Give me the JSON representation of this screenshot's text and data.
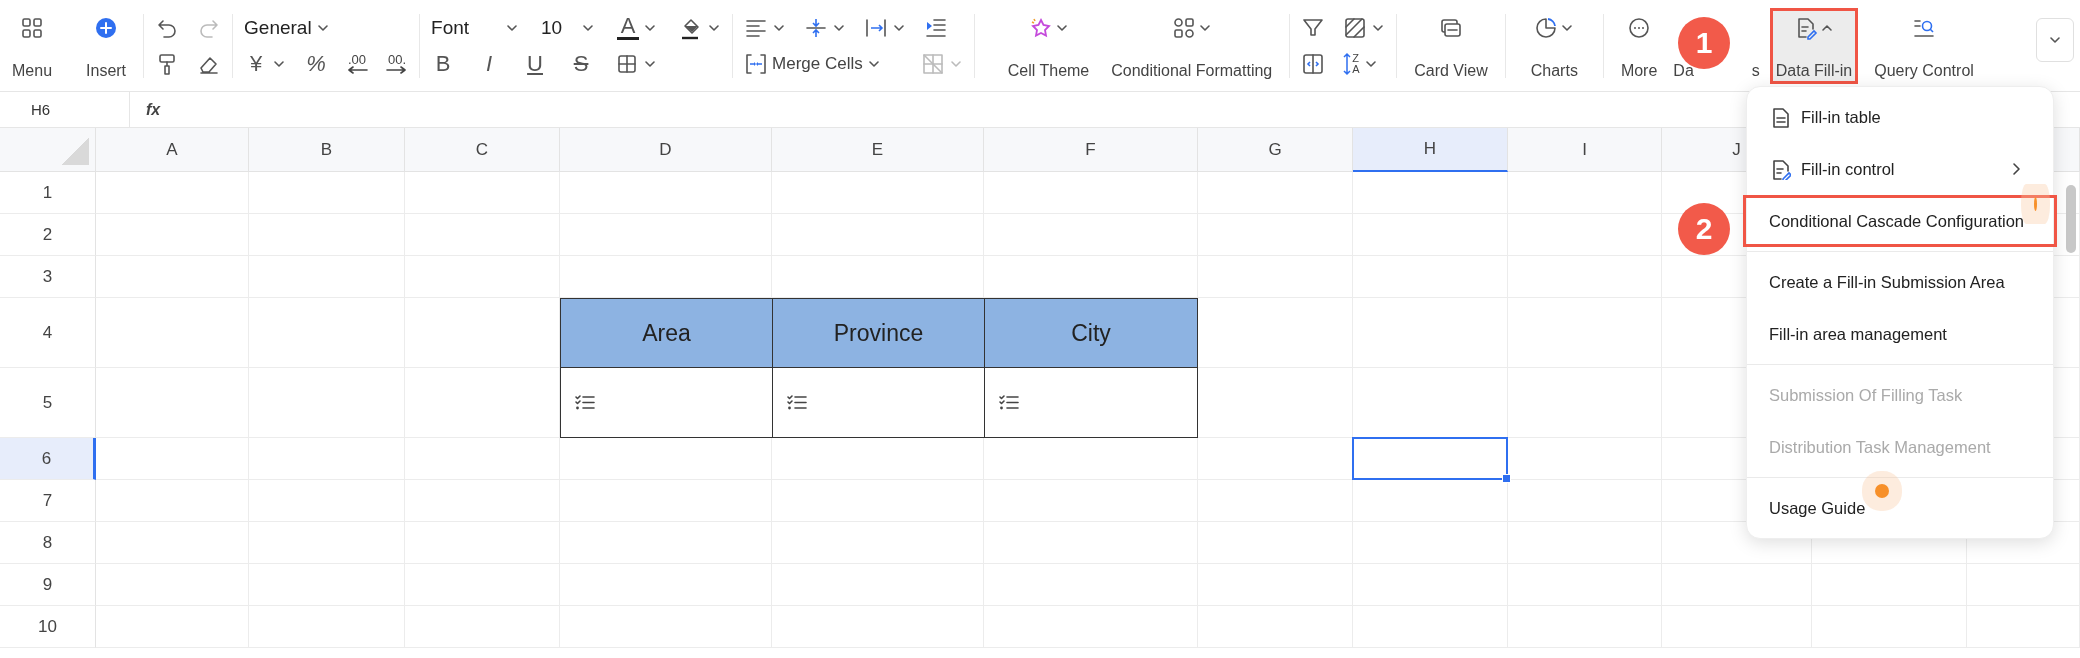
{
  "toolbar": {
    "groups": [
      {
        "kind": "big",
        "items": [
          {
            "label": "Menu",
            "dropdown": false,
            "expanded": false,
            "highlighted": false
          },
          {
            "label": "Insert",
            "dropdown": false,
            "expanded": false,
            "highlighted": false
          }
        ]
      },
      {
        "kind": "grid",
        "rows": [
          [
            {
              "kind": "icon",
              "dropdown": false,
              "disabled": false
            },
            {
              "kind": "icon",
              "dropdown": false,
              "disabled": true
            }
          ],
          [
            {
              "kind": "icon",
              "dropdown": false,
              "disabled": false
            },
            {
              "kind": "icon",
              "dropdown": false,
              "disabled": false
            }
          ]
        ]
      },
      {
        "kind": "grid",
        "rows": [
          [
            {
              "kind": "select",
              "value": "General",
              "disabled": false
            }
          ],
          [
            {
              "kind": "glyph",
              "text": "¥",
              "dropdown": true,
              "disabled": false
            },
            {
              "kind": "glyph",
              "text": "%",
              "dropdown": false,
              "disabled": false
            },
            {
              "kind": "decimal",
              "text": ".00",
              "dropdown": false,
              "disabled": false
            },
            {
              "kind": "decimal",
              "text": "00.",
              "dropdown": false,
              "disabled": false
            }
          ]
        ]
      },
      {
        "kind": "grid",
        "rows": [
          [
            {
              "kind": "select",
              "value": "Font",
              "disabled": false
            },
            {
              "kind": "select",
              "value": "10",
              "disabled": false
            },
            {
              "kind": "fontcolor",
              "text": "A",
              "dropdown": true,
              "disabled": false
            },
            {
              "kind": "icon",
              "dropdown": true,
              "disabled": false
            }
          ],
          [
            {
              "kind": "glyph",
              "text": "B",
              "dropdown": false,
              "disabled": false
            },
            {
              "kind": "glyph",
              "text": "I",
              "dropdown": false,
              "disabled": false
            },
            {
              "kind": "glyph",
              "text": "U",
              "dropdown": false,
              "disabled": false
            },
            {
              "kind": "glyph",
              "text": "S",
              "dropdown": false,
              "disabled": false
            },
            {
              "kind": "icon",
              "dropdown": true,
              "disabled": false
            }
          ]
        ]
      },
      {
        "kind": "grid",
        "rows": [
          [
            {
              "kind": "icon",
              "dropdown": true,
              "disabled": false
            },
            {
              "kind": "icon",
              "dropdown": true,
              "disabled": false
            },
            {
              "kind": "icon",
              "dropdown": true,
              "disabled": false
            },
            {
              "kind": "icon",
              "dropdown": false,
              "disabled": false
            }
          ],
          [
            {
              "kind": "select",
              "value": "Merge Cells",
              "disabled": false
            },
            {
              "kind": "icon",
              "dropdown": true,
              "disabled": true
            }
          ]
        ]
      },
      {
        "kind": "big",
        "items": [
          {
            "label": "Cell Theme",
            "dropdown": true,
            "expanded": false,
            "highlighted": false
          },
          {
            "label": "Conditional Formatting",
            "dropdown": true,
            "expanded": false,
            "highlighted": false
          }
        ]
      },
      {
        "kind": "grid",
        "rows": [
          [
            {
              "kind": "icon",
              "dropdown": false,
              "disabled": false
            },
            {
              "kind": "icon",
              "dropdown": true,
              "disabled": false
            }
          ],
          [
            {
              "kind": "icon",
              "dropdown": false,
              "disabled": false
            },
            {
              "kind": "sort",
              "top": "Z",
              "bottom": "A",
              "dropdown": true,
              "disabled": false
            }
          ]
        ]
      },
      {
        "kind": "big",
        "items": [
          {
            "label": "Card View",
            "dropdown": false,
            "expanded": false,
            "highlighted": false
          }
        ]
      },
      {
        "kind": "big",
        "items": [
          {
            "label": "Charts",
            "dropdown": true,
            "expanded": false,
            "highlighted": false
          }
        ]
      },
      {
        "kind": "big",
        "items": [
          {
            "label": "More",
            "dropdown": false,
            "expanded": false,
            "highlighted": false
          },
          {
            "label": "Da",
            "label_end": "s",
            "dropdown": false,
            "expanded": false,
            "highlighted": false
          },
          {
            "label": "Data Fill-in",
            "dropdown": true,
            "expanded": true,
            "highlighted": true
          },
          {
            "label": "Query Control",
            "dropdown": false,
            "expanded": false,
            "highlighted": false
          }
        ]
      }
    ]
  },
  "formula_bar": {
    "name_box": "H6",
    "function_label": "fx"
  },
  "sheet": {
    "columns": [
      {
        "label": "A",
        "selected": false
      },
      {
        "label": "B",
        "selected": false
      },
      {
        "label": "C",
        "selected": false
      },
      {
        "label": "D",
        "selected": false
      },
      {
        "label": "E",
        "selected": false
      },
      {
        "label": "F",
        "selected": false
      },
      {
        "label": "G",
        "selected": false
      },
      {
        "label": "H",
        "selected": true
      },
      {
        "label": "I",
        "selected": false
      },
      {
        "label": "J",
        "selected": false
      }
    ],
    "rows": [
      {
        "label": "1",
        "selected": false
      },
      {
        "label": "2",
        "selected": false
      },
      {
        "label": "3",
        "selected": false
      },
      {
        "label": "4",
        "selected": false
      },
      {
        "label": "5",
        "selected": false
      },
      {
        "label": "6",
        "selected": true
      },
      {
        "label": "7",
        "selected": false
      },
      {
        "label": "8",
        "selected": false
      },
      {
        "label": "9",
        "selected": false
      },
      {
        "label": "10",
        "selected": false
      }
    ],
    "table": {
      "rows": [
        {
          "cells": [
            {
              "kind": "header",
              "text": "Area"
            },
            {
              "kind": "header",
              "text": "Province"
            },
            {
              "kind": "header",
              "text": "City"
            }
          ]
        },
        {
          "cells": [
            {
              "kind": "list"
            },
            {
              "kind": "list"
            },
            {
              "kind": "list"
            }
          ]
        }
      ]
    }
  },
  "menu": {
    "groups": [
      [
        {
          "label": "Fill-in table",
          "icon": true,
          "submenu": false,
          "disabled": false,
          "highlighted": false,
          "hotspot": false
        },
        {
          "label": "Fill-in control",
          "icon": true,
          "submenu": true,
          "disabled": false,
          "highlighted": false,
          "hotspot": false
        },
        {
          "label": "Conditional Cascade Configuration",
          "icon": false,
          "submenu": false,
          "disabled": false,
          "highlighted": true,
          "hotspot": true
        }
      ],
      [
        {
          "label": "Create a Fill-in Submission Area",
          "icon": false,
          "submenu": false,
          "disabled": false,
          "highlighted": false,
          "hotspot": false
        },
        {
          "label": "Fill-in area management",
          "icon": false,
          "submenu": false,
          "disabled": false,
          "highlighted": false,
          "hotspot": false
        }
      ],
      [
        {
          "label": "Submission Of Filling Task",
          "icon": false,
          "submenu": false,
          "disabled": true,
          "highlighted": false,
          "hotspot": false
        },
        {
          "label": "Distribution Task Management",
          "icon": false,
          "submenu": false,
          "disabled": true,
          "highlighted": false,
          "hotspot": false
        }
      ],
      [
        {
          "label": "Usage Guide",
          "icon": false,
          "submenu": false,
          "disabled": false,
          "highlighted": false,
          "hotspot": true
        }
      ]
    ]
  },
  "badges": [
    {
      "text": "1"
    },
    {
      "text": "2"
    }
  ]
}
